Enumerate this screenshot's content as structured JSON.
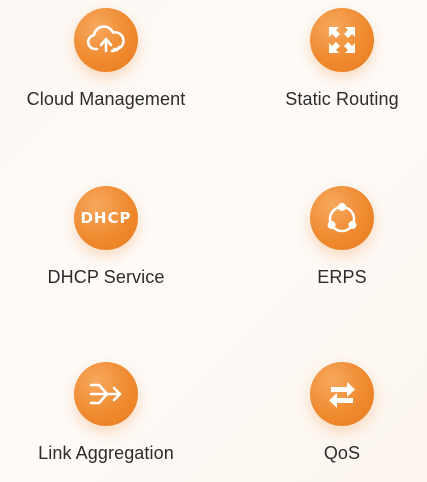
{
  "features": [
    {
      "id": "cloud",
      "label": "Cloud Management",
      "icon": "cloud-upload-icon"
    },
    {
      "id": "static",
      "label": "Static Routing",
      "icon": "arrows-expand-icon"
    },
    {
      "id": "dhcp",
      "label": "DHCP Service",
      "icon": "dhcp-icon",
      "icon_text": "DHCP"
    },
    {
      "id": "erps",
      "label": "ERPS",
      "icon": "ring-network-icon"
    },
    {
      "id": "link",
      "label": "Link Aggregation",
      "icon": "merge-arrows-icon"
    },
    {
      "id": "qos",
      "label": "QoS",
      "icon": "swap-arrows-icon"
    }
  ],
  "colors": {
    "accent": "#ef8a2f",
    "label": "#2c2c2c",
    "background": "#fdf8f3"
  }
}
